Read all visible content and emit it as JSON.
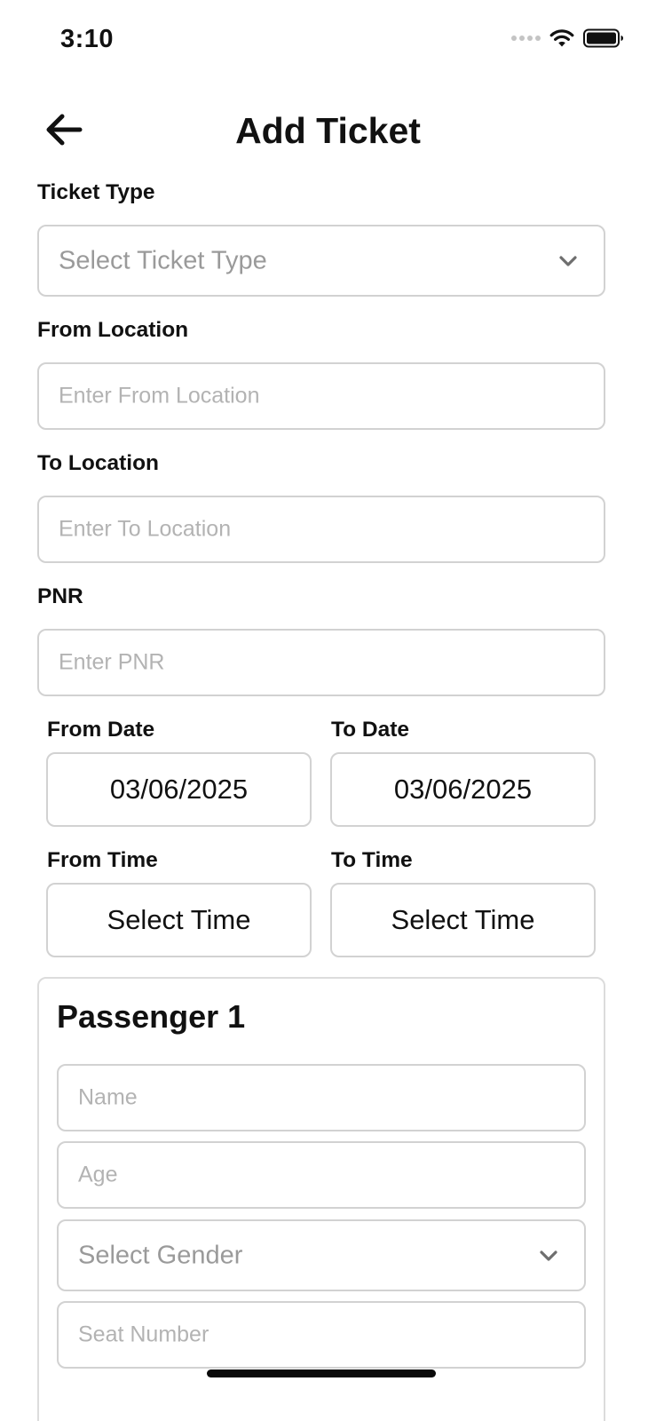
{
  "status_bar": {
    "time": "3:10",
    "icons": [
      "cellular-signal-icon",
      "wifi-icon",
      "battery-icon"
    ]
  },
  "header": {
    "back_icon": "arrow-left-icon",
    "title": "Add Ticket"
  },
  "form": {
    "ticket_type": {
      "label": "Ticket Type",
      "placeholder": "Select Ticket Type",
      "icon": "chevron-down-icon"
    },
    "from_location": {
      "label": "From Location",
      "placeholder": "Enter From Location",
      "value": ""
    },
    "to_location": {
      "label": "To Location",
      "placeholder": "Enter To Location",
      "value": ""
    },
    "pnr": {
      "label": "PNR",
      "placeholder": "Enter PNR",
      "value": ""
    },
    "from_date": {
      "label": "From Date",
      "value": "03/06/2025"
    },
    "to_date": {
      "label": "To Date",
      "value": "03/06/2025"
    },
    "from_time": {
      "label": "From Time",
      "value": "Select Time"
    },
    "to_time": {
      "label": "To Time",
      "value": "Select Time"
    }
  },
  "passenger": {
    "title": "Passenger 1",
    "name": {
      "placeholder": "Name",
      "value": ""
    },
    "age": {
      "placeholder": "Age",
      "value": ""
    },
    "gender": {
      "placeholder": "Select Gender",
      "icon": "chevron-down-icon"
    },
    "seat": {
      "placeholder": "Seat Number",
      "value": ""
    }
  },
  "colors": {
    "text": "#111111",
    "border": "#d2d2d2",
    "placeholder": "#b3b3b3",
    "select_placeholder": "#9a9a9a",
    "background": "#ffffff"
  }
}
